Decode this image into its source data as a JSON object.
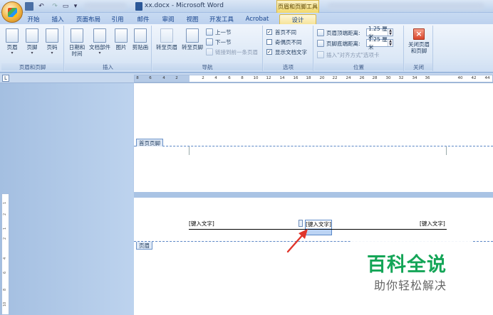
{
  "window": {
    "title": "xx.docx - Microsoft Word",
    "contextual_tab_title": "页眉和页脚工具"
  },
  "tabs": [
    {
      "label": "开始"
    },
    {
      "label": "插入"
    },
    {
      "label": "页面布局"
    },
    {
      "label": "引用"
    },
    {
      "label": "邮件"
    },
    {
      "label": "审阅"
    },
    {
      "label": "视图"
    },
    {
      "label": "开发工具"
    },
    {
      "label": "Acrobat"
    },
    {
      "label": "设计"
    }
  ],
  "ribbon": {
    "group_header_footer": {
      "label": "页眉和页脚",
      "header": "页眉",
      "footer": "页脚",
      "page_number": "页码"
    },
    "group_insert": {
      "label": "插入",
      "date_time_line1": "日期和",
      "date_time_line2": "时间",
      "quick_parts": "文档部件",
      "picture": "图片",
      "clip_art": "剪贴画"
    },
    "group_navigation": {
      "label": "导航",
      "goto_header": "转至页眉",
      "goto_footer": "转至页脚",
      "previous_section": "上一节",
      "next_section": "下一节",
      "link_to_previous": "链接到前一条页眉"
    },
    "group_options": {
      "label": "选项",
      "different_first_page": "首页不同",
      "different_odd_even": "奇偶页不同",
      "show_document_text": "显示文档文字",
      "different_first_page_checked": true,
      "different_odd_even_checked": false,
      "show_document_text_checked": true
    },
    "group_position": {
      "label": "位置",
      "header_from_top_label": "页眉顶端距离:",
      "header_from_top_value": "1.25 厘米",
      "footer_from_bottom_label": "页脚底端距离:",
      "footer_from_bottom_value": "1.25 厘米",
      "insert_alignment_tab": "插入\"对齐方式\"选项卡"
    },
    "group_close": {
      "label": "关闭",
      "close_line1": "关闭页眉",
      "close_line2": "和页脚"
    }
  },
  "ruler": {
    "corner_symbol": "L",
    "ticks": [
      "8",
      "6",
      "4",
      "2",
      "2",
      "4",
      "6",
      "8",
      "10",
      "12",
      "14",
      "16",
      "18",
      "20",
      "22",
      "24",
      "26",
      "28",
      "30",
      "32",
      "34",
      "36",
      "40",
      "42",
      "44"
    ],
    "vertical_ticks": [
      "1",
      "2",
      "1",
      "2",
      "4",
      "6",
      "8",
      "10"
    ]
  },
  "document": {
    "first_page_footer_label": "首页页脚",
    "header_label": "页眉",
    "header_left_text": "[键入文字]",
    "header_center_text": "[键入文字]",
    "header_right_text": "[键入文字]"
  },
  "watermark": {
    "title": "百科全说",
    "subtitle": "助你轻松解决"
  },
  "colors": {
    "ribbon_bg": "#dce8f6",
    "contextual_tab": "#f6e39b",
    "watermark_green": "#14a557",
    "arrow_red": "#e0352b",
    "header_dash": "#5b86c5"
  }
}
